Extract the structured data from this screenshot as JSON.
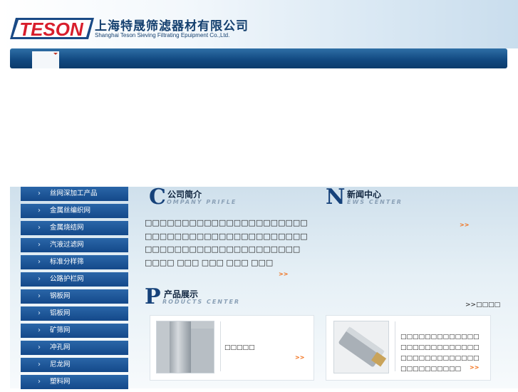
{
  "header": {
    "logo_text": "TESON",
    "company_cn": "上海特晟筛滤器材有限公司",
    "company_en": "Shanghai Teson Sieving Filtrating Epuipment Co.,Ltd.",
    "colors": {
      "brand_red": "#d81e2c",
      "brand_blue": "#1a4a86"
    }
  },
  "nav": {
    "icon": "chevron-down-icon"
  },
  "sidebar": {
    "icon": "chevron-right-icon",
    "items": [
      {
        "label": "丝网深加工产品"
      },
      {
        "label": "金属丝编织网"
      },
      {
        "label": "金属烧结网"
      },
      {
        "label": "汽液过滤网"
      },
      {
        "label": "标准分样筛"
      },
      {
        "label": "公路护栏网"
      },
      {
        "label": "钢板网"
      },
      {
        "label": "铝板网"
      },
      {
        "label": "矿筛网"
      },
      {
        "label": "冲孔网"
      },
      {
        "label": "尼龙网"
      },
      {
        "label": "塑料网"
      }
    ]
  },
  "company": {
    "letter": "C",
    "title_cn": "公司简介",
    "title_en": "OMPANY PRIFLE",
    "text": "□□□□□□□□□□□□□□□□□□□□□□□□□□□□□□□□□□□□□□□□□□□□□□□□□□□□□□□□□□□□□□□□□ □□□□ □□□ □□□ □□□ □□□",
    "more": ">>"
  },
  "news": {
    "letter": "N",
    "title_cn": "新闻中心",
    "title_en": "EWS CENTER",
    "more": ">>"
  },
  "products": {
    "letter": "P",
    "title_cn": "产品展示",
    "title_en": "RODUCTS CENTER",
    "more": ">>□□□□",
    "cards": [
      {
        "text": "□□□□□",
        "more": ">>"
      },
      {
        "text": "□□□□□□□□□□□□□□□□□□□□□□□□□□□□□□□□□□□□□□□□□□□□□□□□□",
        "more": ">>"
      }
    ]
  }
}
